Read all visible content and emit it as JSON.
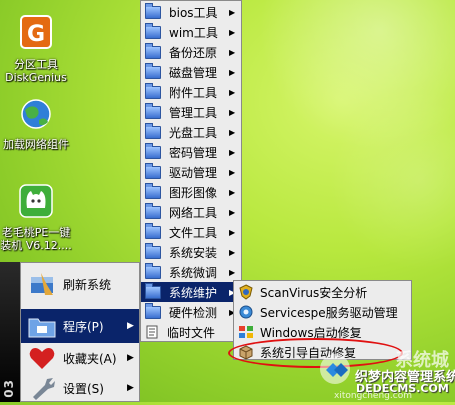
{
  "desktop": {
    "icons": [
      {
        "label_1": "分区工具",
        "label_2": "DiskGenius"
      },
      {
        "label_1": "加载网络组件"
      },
      {
        "label_1": "老毛桃PE一键",
        "label_2": "装机 V6.12...."
      }
    ]
  },
  "start_menu": {
    "strip_text": "03",
    "items": [
      {
        "label": "刷新系统"
      },
      {
        "label": "程序(P)"
      },
      {
        "label": "收藏夹(A)"
      },
      {
        "label": "设置(S)"
      }
    ]
  },
  "programs_menu": {
    "items": [
      {
        "label": "bios工具"
      },
      {
        "label": "wim工具"
      },
      {
        "label": "备份还原"
      },
      {
        "label": "磁盘管理"
      },
      {
        "label": "附件工具"
      },
      {
        "label": "管理工具"
      },
      {
        "label": "光盘工具"
      },
      {
        "label": "密码管理"
      },
      {
        "label": "驱动管理"
      },
      {
        "label": "图形图像"
      },
      {
        "label": "网络工具"
      },
      {
        "label": "文件工具"
      },
      {
        "label": "系统安装"
      },
      {
        "label": "系统微调"
      },
      {
        "label": "系统维护"
      },
      {
        "label": "硬件检测"
      },
      {
        "label": "临时文件"
      }
    ]
  },
  "maintenance_menu": {
    "items": [
      {
        "label": "ScanVirus安全分析"
      },
      {
        "label": "Servicespe服务驱动管理"
      },
      {
        "label": "Windows启动修复"
      },
      {
        "label": "系统引导自动修复"
      }
    ]
  },
  "watermark": {
    "brand": "系统城",
    "name": "织梦内容管理系统",
    "domain": "DEDECMS.COM",
    "url": "xitongcheng.com"
  },
  "colors": {
    "highlight": "#0a246a",
    "menu_bg": "#ececec",
    "annotation": "#e01010"
  }
}
